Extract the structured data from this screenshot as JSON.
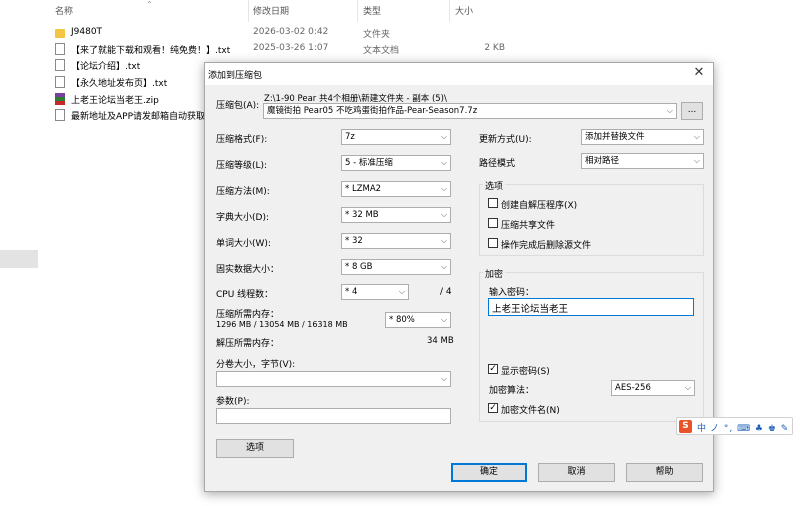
{
  "explorer": {
    "columns": {
      "name": "名称",
      "date": "修改日期",
      "type": "类型",
      "size": "大小"
    },
    "files": [
      {
        "icon": "folder-icon",
        "name": "J9480T",
        "date": "2026-03-02 0:42",
        "type": "文件夹",
        "size": ""
      },
      {
        "icon": "document-icon",
        "name": "【来了就能下载和观看！纯免费！】.txt",
        "date": "2025-03-26 1:07",
        "type": "文本文档",
        "size": "2 KB"
      },
      {
        "icon": "document-icon",
        "name": "【论坛介绍】.txt",
        "date": "",
        "type": "",
        "size": ""
      },
      {
        "icon": "document-icon",
        "name": "【永久地址发布页】.txt",
        "date": "",
        "type": "",
        "size": ""
      },
      {
        "icon": "zip-archive-icon",
        "name": "上老王论坛当老王.zip",
        "date": "",
        "type": "",
        "size": ""
      },
      {
        "icon": "document-icon",
        "name": "最新地址及APP请发邮箱自动获取",
        "date": "",
        "type": "",
        "size": ""
      }
    ]
  },
  "dialog": {
    "title": "添加到压缩包",
    "close": "✕",
    "archive_label": "压缩包(A):",
    "archive_path": "Z:\\1-90 Pear   共4个相册\\新建文件夹 - 副本 (5)\\",
    "archive_name": "魔镜街拍 Pear05 不吃鸡蛋街拍作品-Pear-Season7.7z",
    "browse": "...",
    "format_label": "压缩格式(F):",
    "format": "7z",
    "level_label": "压缩等级(L):",
    "level": "5 - 标准压缩",
    "method_label": "压缩方法(M):",
    "method": "* LZMA2",
    "dict_label": "字典大小(D):",
    "dict": "* 32 MB",
    "word_label": "单词大小(W):",
    "word": "* 32",
    "solid_label": "固实数据大小：",
    "solid": "* 8 GB",
    "cpu_label": "CPU 线程数：",
    "cpu": "* 4",
    "cpu_total": "/ 4",
    "mem_comp_label": "压缩所需内存：",
    "mem_comp_detail": "1296 MB / 13054 MB / 16318 MB",
    "mem_percent": "* 80%",
    "mem_decomp_label": "解压所需内存：",
    "mem_decomp": "34 MB",
    "split_label": "分卷大小，字节(V):",
    "split": "",
    "params_label": "参数(P):",
    "params": "",
    "options_button": "选项",
    "update_label": "更新方式(U):",
    "update": "添加并替换文件",
    "path_label": "路径模式",
    "path_mode": "相对路径",
    "options_group": "选项",
    "opt_sfx": "创建自解压程序(X)",
    "opt_shared": "压缩共享文件",
    "opt_delete": "操作完成后删除源文件",
    "enc_group": "加密",
    "pwd_label": "输入密码：",
    "pwd_value": "上老王论坛当老王",
    "show_pwd": "显示密码(S)",
    "enc_method_label": "加密算法：",
    "enc_method": "AES-256",
    "enc_names": "加密文件名(N)",
    "ok": "确定",
    "cancel": "取消",
    "help": "帮助"
  },
  "ime": {
    "logo": "S",
    "mode": "中",
    "icons": "ノ °, ⌨ ♣ ♚ ✎"
  }
}
